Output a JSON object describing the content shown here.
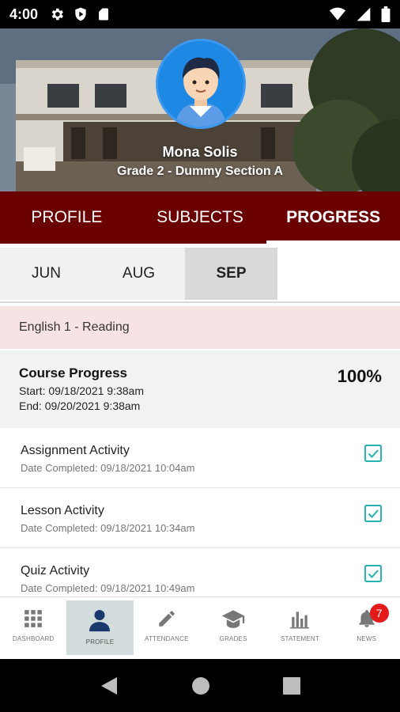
{
  "status_bar": {
    "time": "4:00"
  },
  "profile": {
    "name": "Mona  Solis",
    "grade": "Grade 2 - Dummy Section A"
  },
  "tabs": [
    {
      "label": "PROFILE"
    },
    {
      "label": "SUBJECTS"
    },
    {
      "label": "PROGRESS",
      "active": true
    }
  ],
  "months": [
    {
      "label": "JUN"
    },
    {
      "label": "AUG"
    },
    {
      "label": "SEP",
      "active": true
    }
  ],
  "subject": {
    "title": "English 1 - Reading"
  },
  "course_progress": {
    "title": "Course Progress",
    "start": "Start: 09/18/2021 9:38am",
    "end": "End: 09/20/2021 9:38am",
    "percent": "100%"
  },
  "activities": [
    {
      "title": "Assignment Activity",
      "date": "Date Completed: 09/18/2021 10:04am",
      "completed": true
    },
    {
      "title": "Lesson Activity",
      "date": "Date Completed: 09/18/2021 10:34am",
      "completed": true
    },
    {
      "title": "Quiz Activity",
      "date": "Date Completed: 09/18/2021 10:49am",
      "completed": true
    }
  ],
  "bottom_nav": [
    {
      "label": "DASHBOARD",
      "icon": "grid-icon"
    },
    {
      "label": "PROFILE",
      "icon": "person-icon",
      "active": true
    },
    {
      "label": "ATTENDANCE",
      "icon": "pencil-icon"
    },
    {
      "label": "GRADES",
      "icon": "graduation-cap-icon"
    },
    {
      "label": "STATEMENT",
      "icon": "bar-chart-icon"
    },
    {
      "label": "NEWS",
      "icon": "bell-icon",
      "badge": "7"
    }
  ],
  "colors": {
    "primary": "#6b0000",
    "accent_check": "#26b3b3",
    "subject_bg": "#f7e3e3",
    "badge": "#e31b1b"
  }
}
